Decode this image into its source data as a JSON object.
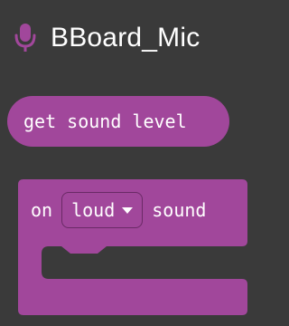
{
  "category": {
    "title": "BBoard_Mic",
    "icon": "microphone-icon",
    "color": "#a1479b"
  },
  "blocks": {
    "reporter": {
      "label": "get sound level"
    },
    "event": {
      "prefix": "on",
      "dropdown_value": "loud",
      "suffix": "sound"
    }
  }
}
